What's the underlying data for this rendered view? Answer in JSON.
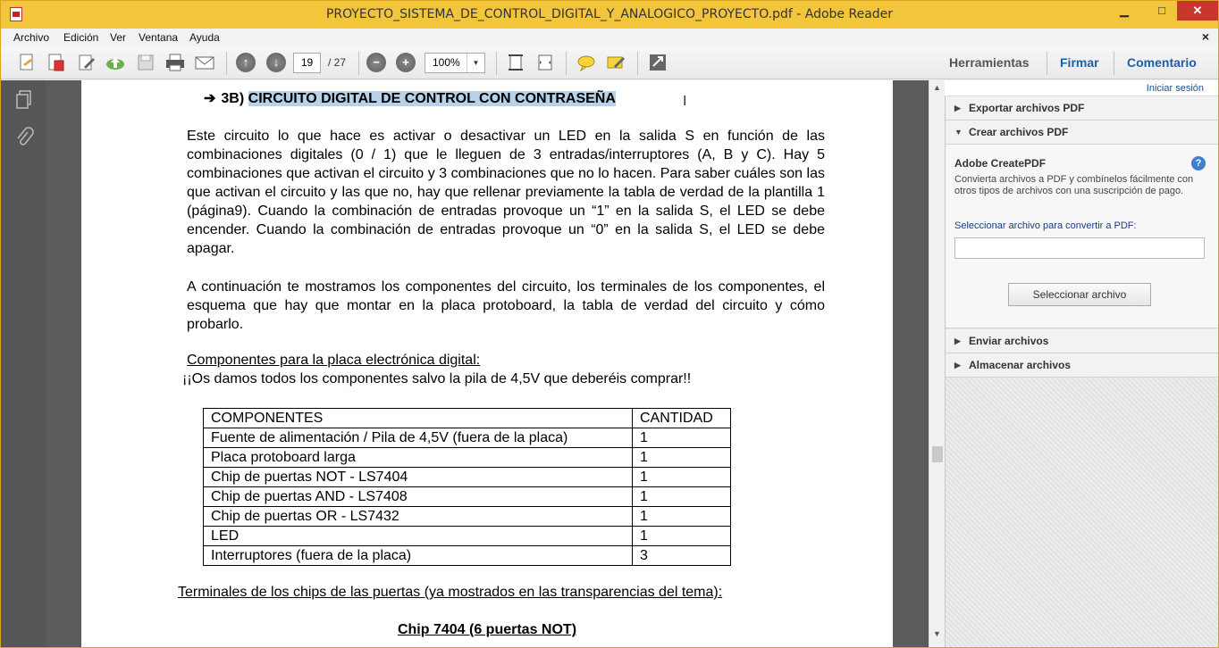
{
  "window": {
    "title": "PROYECTO_SISTEMA_DE_CONTROL_DIGITAL_Y_ANALOGICO_PROYECTO.pdf - Adobe Reader",
    "minimize": "▁",
    "maximize": "□",
    "close": "✕"
  },
  "menubar": {
    "items": [
      "Archivo",
      "Edición",
      "Ver",
      "Ventana",
      "Ayuda"
    ],
    "doc_close": "×"
  },
  "toolbar": {
    "page_current": "19",
    "page_total": "/ 27",
    "zoom": "100%",
    "tools_label": "Herramientas",
    "sign_label": "Firmar",
    "comment_label": "Comentario",
    "accent_color": "#1a5fa8"
  },
  "document": {
    "heading_prefix": "3B)",
    "heading_selected": "CIRCUITO DIGITAL DE CONTROL CON CONTRASEÑA",
    "paragraph1": "Este circuito lo que hace es activar o desactivar un LED en la salida S en función de las combinaciones digitales (0 / 1) que le lleguen de 3 entradas/interruptores (A, B y C). Hay 5 combinaciones que activan el circuito y 3 combinaciones que no lo hacen. Para saber cuáles son las que activan el circuito y las que no, hay que rellenar previamente la tabla de verdad de la plantilla 1 (página9). Cuando la combinación de entradas provoque un “1” en la salida S, el LED se debe encender. Cuando la combinación de entradas provoque un “0” en la salida S, el LED se debe apagar.",
    "paragraph2": "A continuación te mostramos los componentes del circuito, los terminales de los componentes, el esquema que hay que montar en la placa protoboard, la tabla de verdad del circuito y cómo probarlo.",
    "components_title": "Componentes para la placa electrónica digital:",
    "components_note": "¡¡Os damos todos los componentes salvo la pila de 4,5V que deberéis comprar!!",
    "table": {
      "headers": [
        "COMPONENTES",
        "CANTIDAD"
      ],
      "rows": [
        [
          "Fuente de alimentación / Pila de 4,5V (fuera de la placa)",
          "1"
        ],
        [
          "Placa protoboard larga",
          "1"
        ],
        [
          "Chip de puertas NOT - LS7404",
          "1"
        ],
        [
          "Chip de puertas AND - LS7408",
          "1"
        ],
        [
          "Chip de puertas OR - LS7432",
          "1"
        ],
        [
          "LED",
          "1"
        ],
        [
          "Interruptores (fuera de la placa)",
          "3"
        ]
      ]
    },
    "terminals_title": "Terminales de los chips de las puertas (ya mostrados en las transparencias del tema):",
    "chip_title": "Chip 7404 (6 puertas NOT)"
  },
  "rightpane": {
    "signin": "Iniciar sesión",
    "export_label": "Exportar archivos PDF",
    "create_label": "Crear archivos PDF",
    "create_title": "Adobe CreatePDF",
    "create_desc": "Convierta archivos a PDF y combínelos fácilmente con otros tipos de archivos con una suscripción de pago.",
    "select_label": "Seleccionar archivo para convertir a PDF:",
    "select_button": "Seleccionar archivo",
    "send_label": "Enviar archivos",
    "store_label": "Almacenar archivos"
  }
}
